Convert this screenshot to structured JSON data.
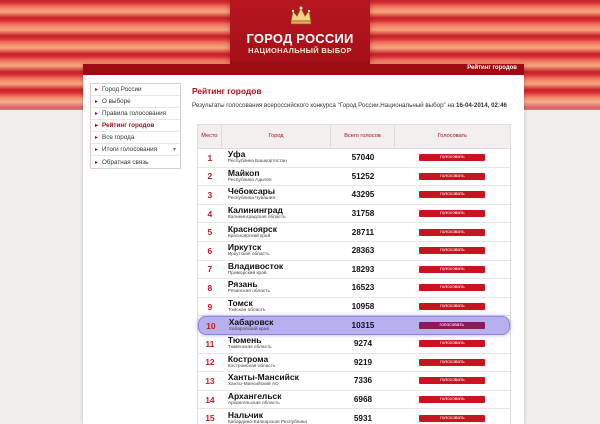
{
  "header": {
    "logo_title": "ГОРОД РОССИИ",
    "logo_subtitle": "НАЦИОНАЛЬНЫЙ ВЫБОР",
    "topbar_link": "Рейтинг городов"
  },
  "sidebar": {
    "items": [
      {
        "label": "Город России",
        "active": false
      },
      {
        "label": "О выборе",
        "active": false
      },
      {
        "label": "Правила голосования",
        "active": false
      },
      {
        "label": "Рейтинг городов",
        "active": true
      },
      {
        "label": "Все города",
        "active": false
      },
      {
        "label": "Итоги голосования",
        "active": false
      },
      {
        "label": "Обратная связь",
        "active": false
      }
    ]
  },
  "main": {
    "title": "Рейтинг городов",
    "subtitle_text": "Результаты голосования всероссийского конкурса \"Город России.Национальный выбор\" на",
    "subtitle_date": "16-04-2014, 02:46"
  },
  "table": {
    "headers": {
      "rank": "Место",
      "city": "Город",
      "votes": "Всего голосов",
      "vote": "Голосовать"
    },
    "button_label": "голосовать",
    "rows": [
      {
        "rank": "1",
        "city": "Уфа",
        "region": "Республика Башкортостан",
        "votes": "57040"
      },
      {
        "rank": "2",
        "city": "Майкоп",
        "region": "Республика Адыгея",
        "votes": "51252"
      },
      {
        "rank": "3",
        "city": "Чебоксары",
        "region": "Республика Чувашия",
        "votes": "43295"
      },
      {
        "rank": "4",
        "city": "Калининград",
        "region": "Калининградская область",
        "votes": "31758"
      },
      {
        "rank": "5",
        "city": "Красноярск",
        "region": "Красноярский край",
        "votes": "28711"
      },
      {
        "rank": "6",
        "city": "Иркутск",
        "region": "Иркутская область",
        "votes": "28363"
      },
      {
        "rank": "7",
        "city": "Владивосток",
        "region": "Приморский край",
        "votes": "18293"
      },
      {
        "rank": "8",
        "city": "Рязань",
        "region": "Рязанская область",
        "votes": "16523"
      },
      {
        "rank": "9",
        "city": "Томск",
        "region": "Томская область",
        "votes": "10958"
      },
      {
        "rank": "10",
        "city": "Хабаровск",
        "region": "Хабаровский край",
        "votes": "10315",
        "highlight": true
      },
      {
        "rank": "11",
        "city": "Тюмень",
        "region": "Тюменская область",
        "votes": "9274"
      },
      {
        "rank": "12",
        "city": "Кострома",
        "region": "Костромская область",
        "votes": "9219"
      },
      {
        "rank": "13",
        "city": "Ханты-Мансийск",
        "region": "Ханты-Мансийский АО",
        "votes": "7336"
      },
      {
        "rank": "14",
        "city": "Архангельск",
        "region": "Архангельская область",
        "votes": "6968"
      },
      {
        "rank": "15",
        "city": "Нальчик",
        "region": "Кабардино-Балкарская Республика",
        "votes": "5931"
      }
    ]
  },
  "colors": {
    "brand_red": "#a0101a",
    "button_red": "#c81420",
    "highlight": "#b7b0ef"
  }
}
